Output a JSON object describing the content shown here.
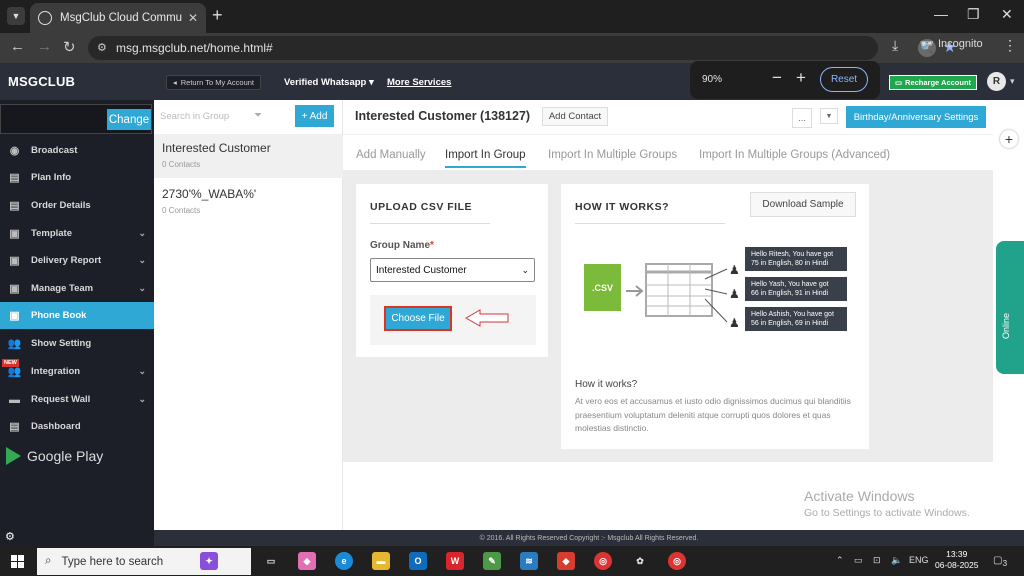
{
  "browser": {
    "tab_title": "MsgClub Cloud Communicatio",
    "url": "msg.msgclub.net/home.html#",
    "incognito_label": "Incognito"
  },
  "zoom_popup": {
    "percent": "90%",
    "minus": "−",
    "plus": "+",
    "reset": "Reset"
  },
  "header": {
    "logo": "MSGCLUB",
    "back": "Return To My Account",
    "whatsapp": "Verified Whatsapp",
    "more": "More Services",
    "recharge": "Recharge Account",
    "avatar": "R"
  },
  "sidebar": {
    "change": "Change",
    "new_badge": "NEW",
    "items": [
      {
        "label": "Broadcast"
      },
      {
        "label": "Plan Info"
      },
      {
        "label": "Order Details"
      },
      {
        "label": "Template"
      },
      {
        "label": "Delivery Report"
      },
      {
        "label": "Manage Team"
      },
      {
        "label": "Phone Book"
      },
      {
        "label": "Show Setting"
      },
      {
        "label": "Integration"
      },
      {
        "label": "Request Wall"
      },
      {
        "label": "Dashboard"
      }
    ],
    "google_play": "Google Play"
  },
  "groups": {
    "search_placeholder": "Search in Group",
    "add": "+ Add",
    "list": [
      {
        "name": "Interested Customer",
        "count": "0 Contacts"
      },
      {
        "name": "2730'%_WABA%'",
        "count": "0 Contacts"
      }
    ]
  },
  "main": {
    "title": "Interested Customer (138127)",
    "add_contact": "Add Contact",
    "dots": "...",
    "bday": "Birthday/Anniversary Settings",
    "tabs": [
      "Add Manually",
      "Import In Group",
      "Import In Multiple Groups",
      "Import In Multiple Groups (Advanced)"
    ],
    "upload": {
      "heading": "UPLOAD CSV FILE",
      "group_label": "Group Name",
      "required": "*",
      "group_value": "Interested Customer",
      "choose": "Choose File"
    },
    "how": {
      "heading": "HOW IT WORKS?",
      "download": "Download Sample",
      "csv": ".CSV",
      "bubbles": [
        [
          "Hello Ritesh, You have got",
          "75 in English, 80 in Hindi"
        ],
        [
          "Hello Yash, You have got",
          "66 in English, 91 in Hindi"
        ],
        [
          "Hello Ashish, You have got",
          "56 in English, 69 in Hindi"
        ]
      ],
      "title2": "How it works?",
      "para": "At vero eos et accusamus et iusto odio dignissimos ducimus qui blanditiis praesentium voluptatum deleniti atque corrupti quos dolores et quas molestias distinctio."
    }
  },
  "activate": {
    "line1": "Activate Windows",
    "line2": "Go to Settings to activate Windows."
  },
  "footer": "© 2016. All Rights Reserved Copyright :- Msgclub All Rights Reserved.",
  "online": "Online",
  "taskbar": {
    "search": "Type here to search",
    "lang": "ENG",
    "time": "13:39",
    "date": "06-08-2025",
    "notif": "3"
  }
}
